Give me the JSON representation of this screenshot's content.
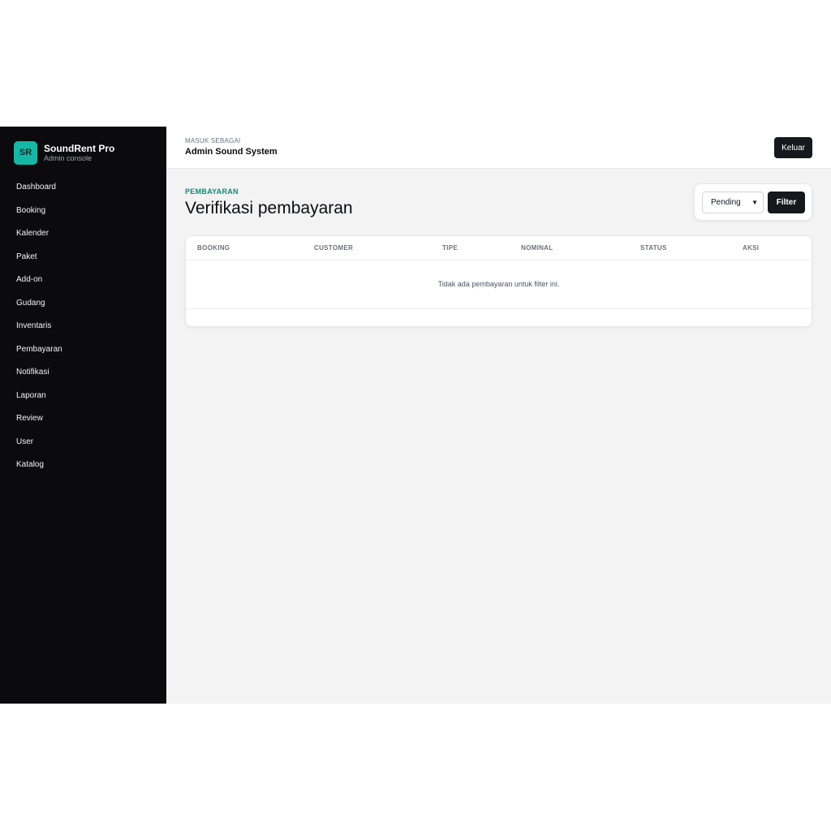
{
  "sidebar": {
    "logo_text": "SR",
    "brand_name": "SoundRent Pro",
    "brand_sub": "Admin console",
    "items": [
      {
        "label": "Dashboard"
      },
      {
        "label": "Booking"
      },
      {
        "label": "Kalender"
      },
      {
        "label": "Paket"
      },
      {
        "label": "Add-on"
      },
      {
        "label": "Gudang"
      },
      {
        "label": "Inventaris"
      },
      {
        "label": "Pembayaran"
      },
      {
        "label": "Notifikasi"
      },
      {
        "label": "Laporan"
      },
      {
        "label": "Review"
      },
      {
        "label": "User"
      },
      {
        "label": "Katalog"
      }
    ]
  },
  "header": {
    "role_caption": "MASUK SEBAGAI",
    "role_name": "Admin Sound System",
    "logout_label": "Keluar"
  },
  "page": {
    "eyebrow": "PEMBAYARAN",
    "title": "Verifikasi pembayaran"
  },
  "filter": {
    "status_value": "Pending",
    "button_label": "Filter"
  },
  "table": {
    "columns": [
      "BOOKING",
      "CUSTOMER",
      "TIPE",
      "NOMINAL",
      "STATUS",
      "AKSI"
    ],
    "empty_message": "Tidak ada pembayaran untuk filter ini."
  },
  "colors": {
    "accent": "#14b8a6",
    "eyebrow": "#0f8a7a",
    "sidebar_bg": "#0b0b0d",
    "button_bg": "#16181d"
  }
}
